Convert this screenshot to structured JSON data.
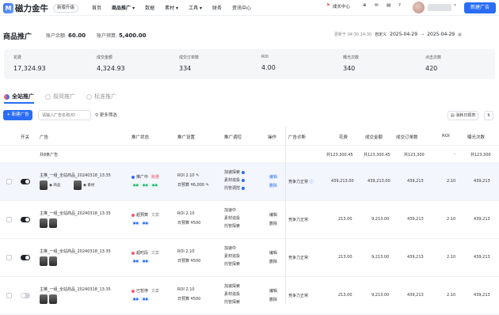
{
  "header": {
    "logo": "磁力金牛",
    "logo_mark": "M",
    "version": "新版升级",
    "nav": [
      "首页",
      "商品推广 ▾",
      "数据",
      "素材 ▾",
      "工具 ▾",
      "财务",
      "资讯中心"
    ],
    "growth": "成长中心",
    "new_ad": "新建广告"
  },
  "page": {
    "title": "商品推广",
    "balance_label": "账户余额:",
    "balance_value": "60.00",
    "budget_label": "账户预算:",
    "budget_value": "5,400.00",
    "update_time": "更新于 04-30 14:30",
    "range_label": "自定义",
    "date_from": "2025-04-29",
    "date_to": "2025-04-29"
  },
  "stats": [
    {
      "label": "花费",
      "value": "17,324.93"
    },
    {
      "label": "成交金额",
      "value": "4,324.93"
    },
    {
      "label": "成交订单数",
      "value": "334"
    },
    {
      "label": "ROI",
      "value": "4.00"
    },
    {
      "label": "曝光次数",
      "value": "340"
    },
    {
      "label": "点击次数",
      "value": "420"
    }
  ],
  "tabs": [
    "全站推广",
    "极简推广",
    "标准推广"
  ],
  "toolbar": {
    "new_ad": "+ 新建广告",
    "search_placeholder": "请输入广告名称/ID",
    "filter": "更多筛选",
    "consume": "消耗日报表",
    "more": "⇅"
  },
  "columns": [
    "开关",
    "广告",
    "推广状态",
    "推广设置",
    "推广调控",
    "操作",
    "广告诊断",
    "花费",
    "成交金额",
    "成交订单数",
    "ROI",
    "曝光次数"
  ],
  "summary": {
    "label": "共8条广告",
    "cost": "共123,300.45",
    "gmv": "共123,300.45",
    "orders": "共123,300",
    "roi": "-",
    "impressions": "共123,300"
  },
  "rows": [
    {
      "name": "主推_一组_全站商品_20240318_13:35",
      "status": "推广中",
      "tag": "跑量",
      "roi": "ROI 2.10",
      "budget": "日预算 ¥6,000",
      "ctrl": [
        "加速探索",
        "素材追投",
        "托管调控"
      ],
      "ops": [
        "编辑",
        "删除"
      ],
      "diag": "竞争力正常",
      "cost": "439,213.00",
      "gmv": "439,213.00",
      "orders": "439,213",
      "roi_val": "2.10",
      "imp": "439,213"
    },
    {
      "name": "主推_一组_全站商品_20240318_13:35",
      "status": "超预算",
      "tag": "文案",
      "roi": "ROI 2.10",
      "budget": "日预算 ¥500",
      "ctrl": [
        "加速中",
        "素材追投",
        "托管探索"
      ],
      "ops": [
        "编辑",
        "删除"
      ],
      "diag": "竞争力正常",
      "cost": "213.00",
      "gmv": "9,213.00",
      "orders": "439,213",
      "roi_val": "2.10",
      "imp": "439,213"
    },
    {
      "name": "主推_一组_全站商品_20240318_13:35",
      "status": "超时段",
      "tag": "文案",
      "roi": "ROI 2.10",
      "budget": "日预算 ¥500",
      "ctrl": [
        "加速中",
        "素材追投",
        "托管探索"
      ],
      "ops": [
        "编辑",
        "删除"
      ],
      "diag": "竞争力正常",
      "cost": "213.00",
      "gmv": "9,213.00",
      "orders": "439,213",
      "roi_val": "2.10",
      "imp": "439,213"
    },
    {
      "name": "主推_一组_全站商品_20240318_13:35",
      "status": "已暂停",
      "tag": "文案",
      "roi": "ROI 2.10",
      "budget": "日预算 ¥500",
      "ctrl": [
        "加速探索",
        "素材追投",
        "托管探索"
      ],
      "ops": [
        "编辑",
        "删除"
      ],
      "diag": "竞争力正常",
      "cost": "213.00",
      "gmv": "9,213.00",
      "orders": "439,213",
      "roi_val": "2.10",
      "imp": "439,213"
    }
  ],
  "colors": {
    "primary": "#2a6df4",
    "green": "#22b573",
    "red": "#f45b69"
  }
}
